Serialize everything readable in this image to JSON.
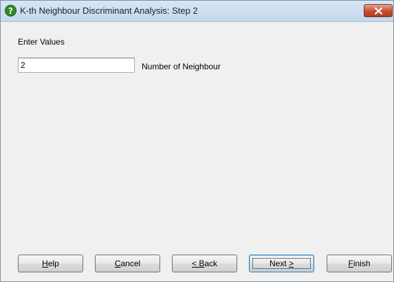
{
  "window": {
    "title": "K-th Neighbour Discriminant Analysis: Step 2",
    "icon": "help-question-icon",
    "accent_color": "#2e8b2e"
  },
  "form": {
    "heading": "Enter Values",
    "neighbour_value": "2",
    "neighbour_label": "Number of Neighbour"
  },
  "buttons": {
    "help": {
      "mnemonic": "H",
      "rest": "elp"
    },
    "cancel": {
      "mnemonic": "C",
      "rest": "ancel"
    },
    "back": {
      "pre": "< ",
      "mnemonic": "B",
      "rest": "ack"
    },
    "next": {
      "pre": "Next ",
      "mnemonic": ">",
      "rest": ""
    },
    "finish": {
      "mnemonic": "F",
      "rest": "inish"
    }
  }
}
